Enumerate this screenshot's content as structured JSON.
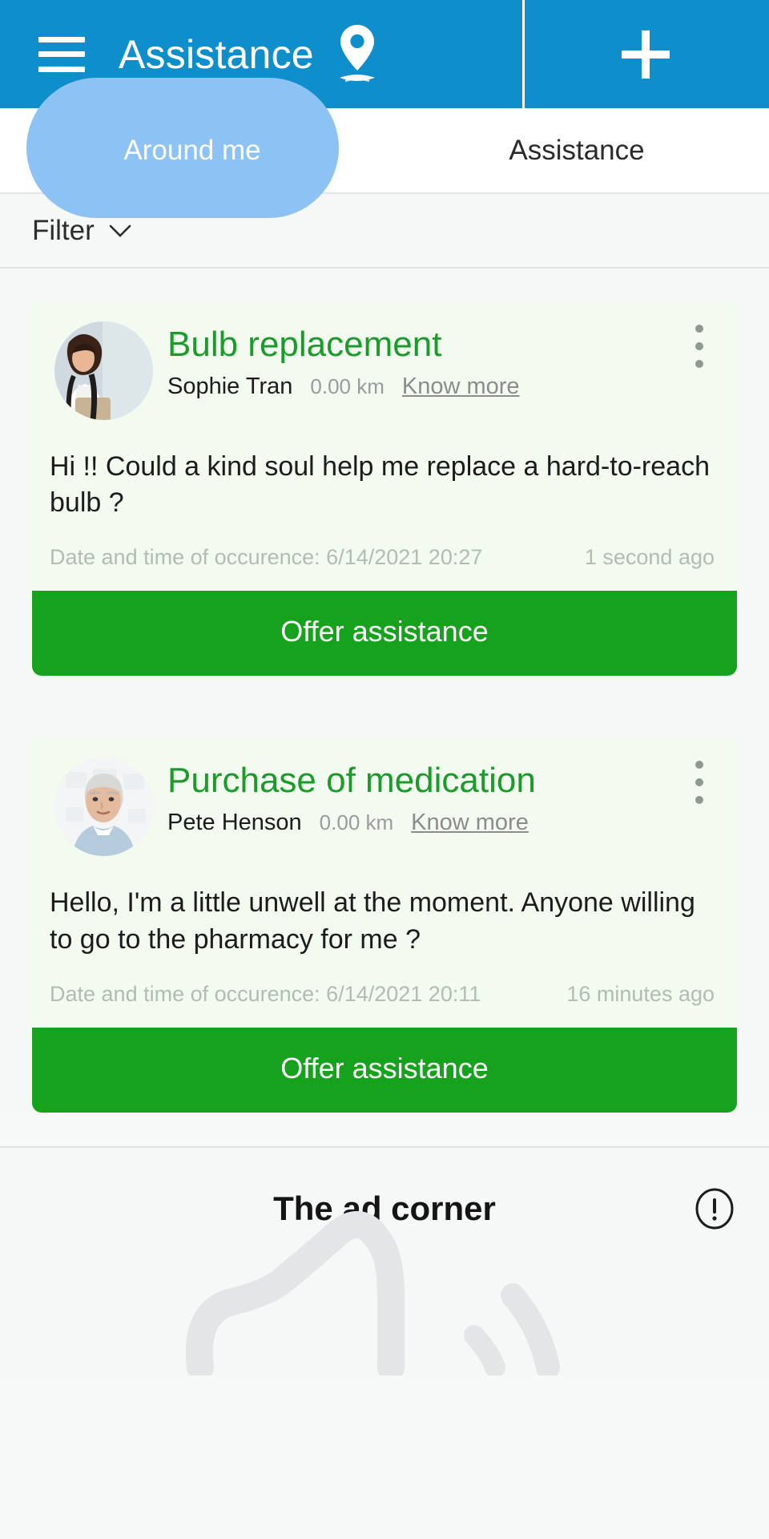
{
  "appbar": {
    "title": "Assistance",
    "menu_icon": "hamburger-menu-icon",
    "location_icon": "map-pin-icon",
    "add_icon": "plus-icon",
    "background_color": "#0e8ecb"
  },
  "tabs": [
    {
      "label": "Around me",
      "active": true
    },
    {
      "label": "Assistance",
      "active": false
    }
  ],
  "filter": {
    "label": "Filter",
    "chevron_icon": "chevron-down-icon"
  },
  "cards": [
    {
      "title": "Bulb replacement",
      "author": "Sophie Tran",
      "distance": "0.00 km",
      "know_more": "Know more",
      "body": "Hi !! Could a kind soul help me replace a hard-to-reach bulb ?",
      "occurrence": "Date and time of occurence: 6/14/2021 20:27",
      "relative_time": "1 second ago",
      "action_label": "Offer assistance",
      "menu_icon": "kebab-menu-icon",
      "avatar_icon": "user-avatar-photo",
      "title_color": "#1a9b2a",
      "action_color": "#16a21c"
    },
    {
      "title": "Purchase of medication",
      "author": "Pete Henson",
      "distance": "0.00 km",
      "know_more": "Know more",
      "body": "Hello, I'm a little unwell at the moment. Anyone willing to go to the pharmacy for me ?",
      "occurrence": "Date and time of occurence: 6/14/2021 20:11",
      "relative_time": "16 minutes ago",
      "action_label": "Offer assistance",
      "menu_icon": "kebab-menu-icon",
      "avatar_icon": "user-avatar-photo",
      "title_color": "#1a9b2a",
      "action_color": "#16a21c"
    }
  ],
  "ad_section": {
    "title": "The ad corner",
    "info_icon": "exclamation-circle-icon",
    "watermark_icon": "brand-watermark"
  }
}
